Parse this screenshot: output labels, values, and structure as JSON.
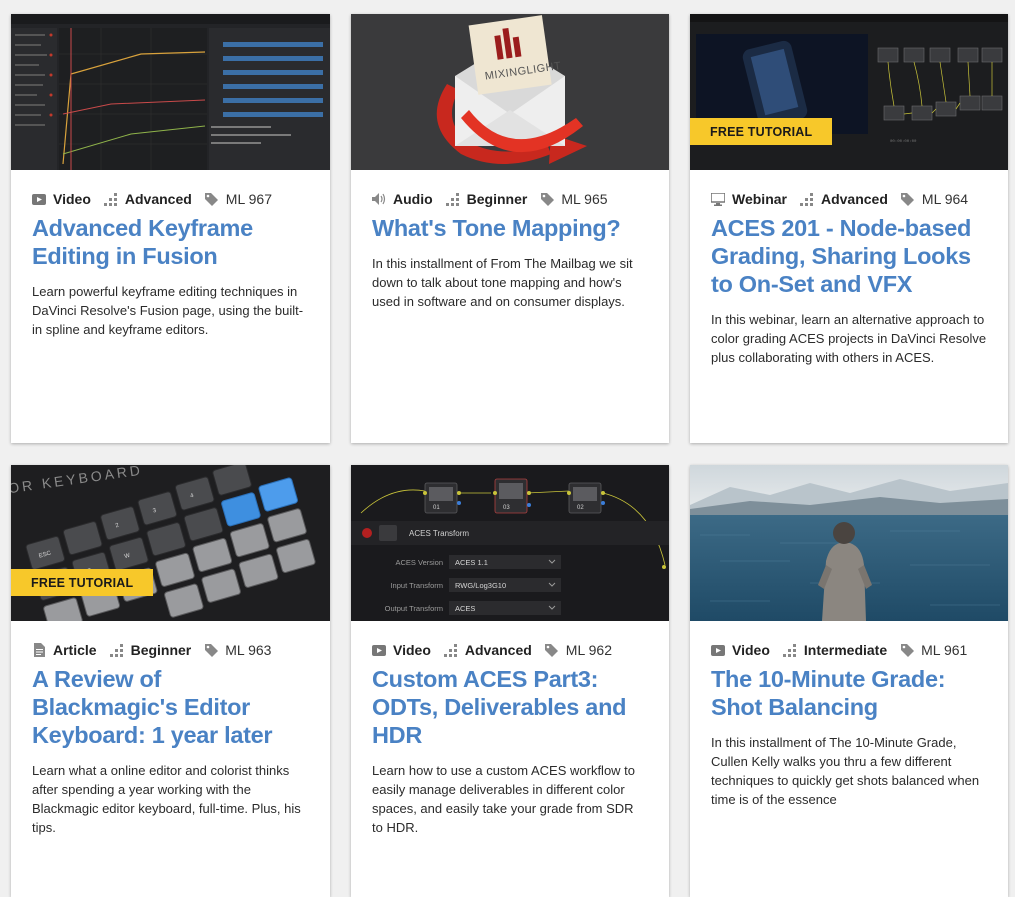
{
  "cards": [
    {
      "format": "Video",
      "format_icon": "video-icon",
      "level": "Advanced",
      "code": "ML 967",
      "title": "Advanced Keyframe Editing in Fusion",
      "description": "Learn powerful keyframe editing techniques in DaVinci Resolve's Fusion page, using the built-in spline and keyframe editors.",
      "badge": ""
    },
    {
      "format": "Audio",
      "format_icon": "speaker-icon",
      "level": "Beginner",
      "code": "ML 965",
      "title": "What's Tone Mapping?",
      "description": "In this installment of From The Mailbag we sit down to talk about tone mapping and how's used in software and on consumer displays.",
      "badge": "",
      "thumb_logo": "MIXINGLIGHT"
    },
    {
      "format": "Webinar",
      "format_icon": "monitor-icon",
      "level": "Advanced",
      "code": "ML 964",
      "title": "ACES 201 - Node-based Grading, Sharing Looks to On-Set and VFX",
      "description": "In this webinar, learn an alternative approach to color grading ACES projects in DaVinci Resolve plus collaborating with others in ACES.",
      "badge": "FREE TUTORIAL"
    },
    {
      "format": "Article",
      "format_icon": "document-icon",
      "level": "Beginner",
      "code": "ML 963",
      "title": "A Review of Blackmagic's Editor Keyboard: 1 year later",
      "description": "Learn what a online editor and colorist thinks after spending a year working with the Blackmagic editor keyboard, full-time. Plus, his tips.",
      "badge": "FREE TUTORIAL",
      "thumb_text": "OR KEYBOARD"
    },
    {
      "format": "Video",
      "format_icon": "video-icon",
      "level": "Advanced",
      "code": "ML 962",
      "title": "Custom ACES Part3: ODTs, Deliverables and HDR",
      "description": "Learn how to use a custom ACES workflow to easily manage deliverables in different color spaces, and easily take your grade from SDR to HDR.",
      "badge": "",
      "thumb_panel": {
        "header": "ACES Transform",
        "rows": [
          {
            "label": "ACES Version",
            "value": "ACES 1.1"
          },
          {
            "label": "Input Transform",
            "value": "RWG/Log3G10"
          },
          {
            "label": "Output Transform",
            "value": "ACES"
          }
        ],
        "nodes": [
          "01",
          "03",
          "02"
        ]
      }
    },
    {
      "format": "Video",
      "format_icon": "video-icon",
      "level": "Intermediate",
      "code": "ML 961",
      "title": "The 10-Minute Grade: Shot Balancing",
      "description": "In this installment of The 10-Minute Grade, Cullen Kelly walks you thru a few different techniques to quickly get shots balanced when time is of the essence",
      "badge": ""
    }
  ],
  "colors": {
    "title": "#4a82c4",
    "badge_bg": "#f7c82a",
    "page_bg": "#f0f0f0"
  }
}
